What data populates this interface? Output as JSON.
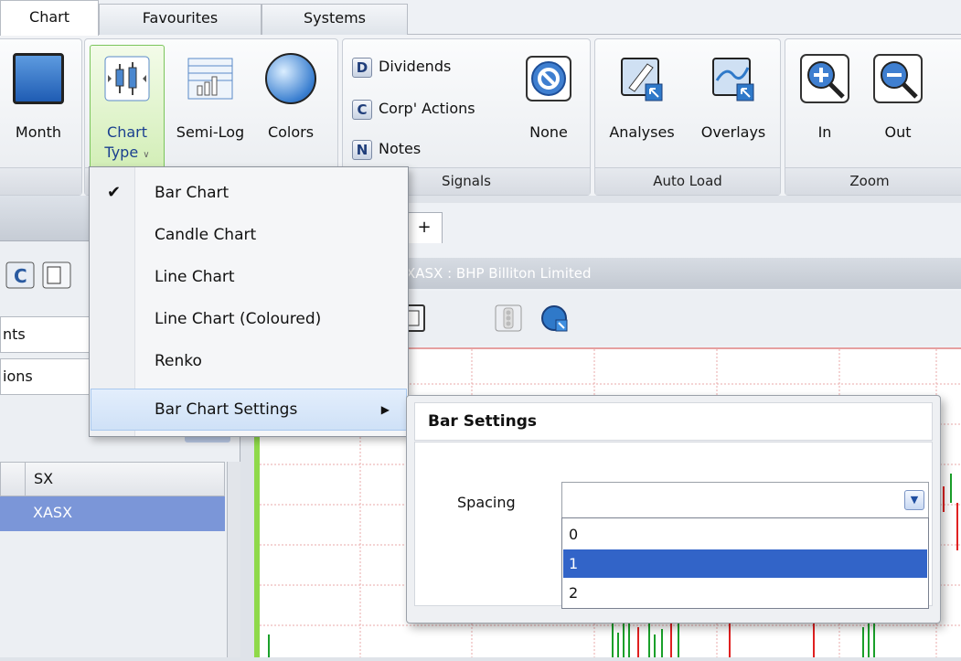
{
  "tabs": [
    "Chart",
    "Favourites",
    "Systems"
  ],
  "ribbon": {
    "month_label": "Month",
    "chart_type_label_1": "Chart",
    "chart_type_label_2": "Type",
    "semilog_label": "Semi-Log",
    "colors_label": "Colors",
    "dividends_label": "Dividends",
    "corp_actions_label": "Corp' Actions",
    "notes_label": "Notes",
    "none_label": "None",
    "signals_group": "Signals",
    "analyses_label": "Analyses",
    "overlays_label": "Overlays",
    "autoload_group": "Auto Load",
    "zoom_in_label": "In",
    "zoom_out_label": "Out",
    "zoom_group": "Zoom",
    "letters": {
      "dividends": "D",
      "corp_actions": "C",
      "notes": "N"
    }
  },
  "left_panel": {
    "field1": "nts",
    "field2": "ions",
    "grid_header": "SX",
    "grid_row": "XASX"
  },
  "chart": {
    "add_tab": "+",
    "title": "XASX : BHP Billiton Limited"
  },
  "menu": {
    "items": [
      {
        "label": "Bar Chart",
        "checked": true
      },
      {
        "label": "Candle Chart"
      },
      {
        "label": "Line Chart"
      },
      {
        "label": "Line Chart (Coloured)"
      },
      {
        "label": "Renko"
      },
      {
        "label": "Bar Chart Settings",
        "submenu": true
      }
    ]
  },
  "bar_settings": {
    "title": "Bar Settings",
    "spacing_label": "Spacing",
    "spacing_value": "",
    "options": [
      "0",
      "1",
      "2"
    ],
    "selected_option": "1"
  }
}
